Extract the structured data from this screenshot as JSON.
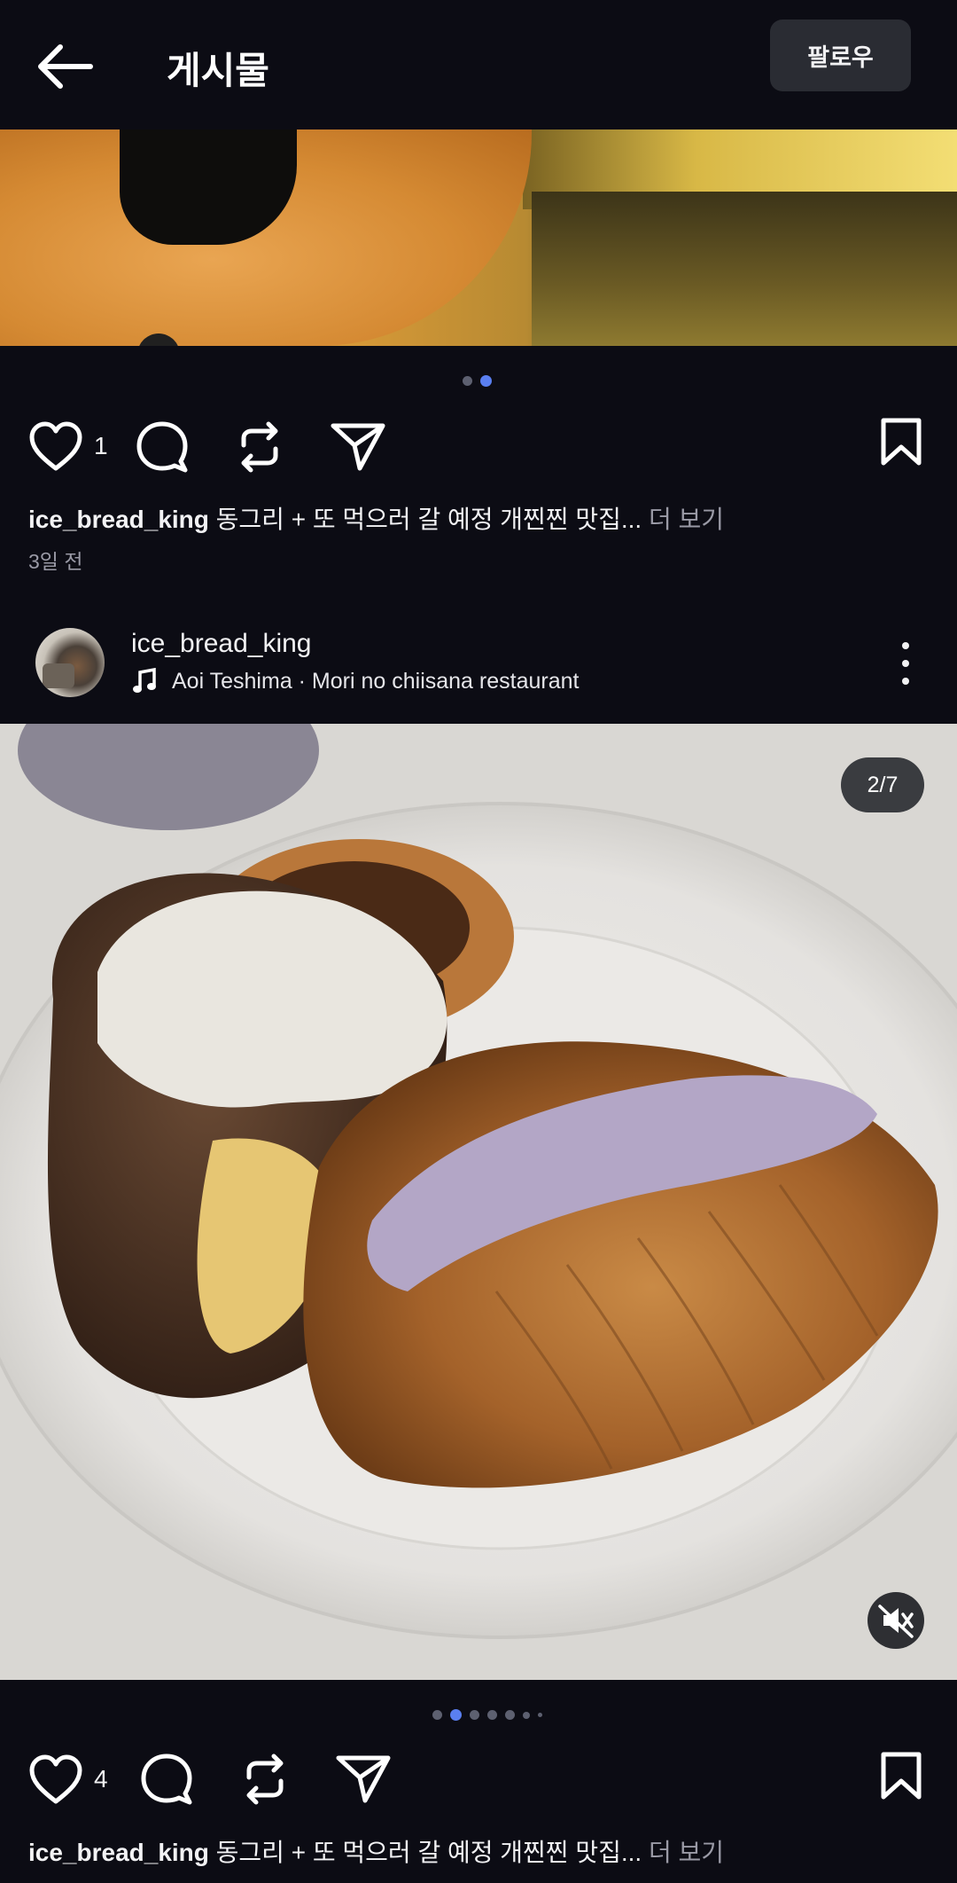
{
  "header": {
    "title": "게시물",
    "follow_label": "팔로우"
  },
  "post1": {
    "likes": "1",
    "username": "ice_bread_king",
    "caption": " 동그리 + 또 먹으러 갈 예정 개찐찐 맛집...",
    "more": " 더 보기",
    "time": "3일 전",
    "page": 2,
    "total": 2
  },
  "post2": {
    "username": "ice_bread_king",
    "song": "Aoi Teshima · Mori no chiisana restaurant",
    "counter": "2/7",
    "likes": "4",
    "caption": " 동그리 + 또 먹으러 갈 예정 개찐찐 맛집...",
    "more": " 더 보기",
    "page": 2,
    "total": 7
  },
  "icons": [
    "back-arrow-icon",
    "heart-icon",
    "comment-icon",
    "repost-icon",
    "send-icon",
    "bookmark-icon",
    "music-note-icon",
    "more-options-icon",
    "mute-icon"
  ],
  "colors": {
    "background": "#0c0c14",
    "accent": "#5a7ff0",
    "muted_text": "#9a9aa6"
  }
}
